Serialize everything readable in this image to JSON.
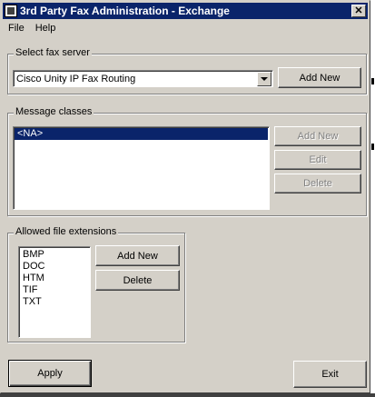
{
  "window": {
    "title": "3rd Party Fax Administration - Exchange",
    "close_glyph": "✕"
  },
  "menu": [
    "File",
    "Help"
  ],
  "fax_server": {
    "group_label": "Select fax server",
    "selected": "Cisco Unity IP Fax Routing",
    "add_label": "Add New"
  },
  "message_classes": {
    "group_label": "Message classes",
    "items": [
      "<NA>"
    ],
    "selected_index": 0,
    "add_label": "Add New",
    "edit_label": "Edit",
    "delete_label": "Delete"
  },
  "extensions": {
    "group_label": "Allowed file extensions",
    "items": [
      "BMP",
      "DOC",
      "HTM",
      "TIF",
      "TXT"
    ],
    "add_label": "Add New",
    "delete_label": "Delete"
  },
  "footer": {
    "apply_label": "Apply",
    "exit_label": "Exit"
  }
}
